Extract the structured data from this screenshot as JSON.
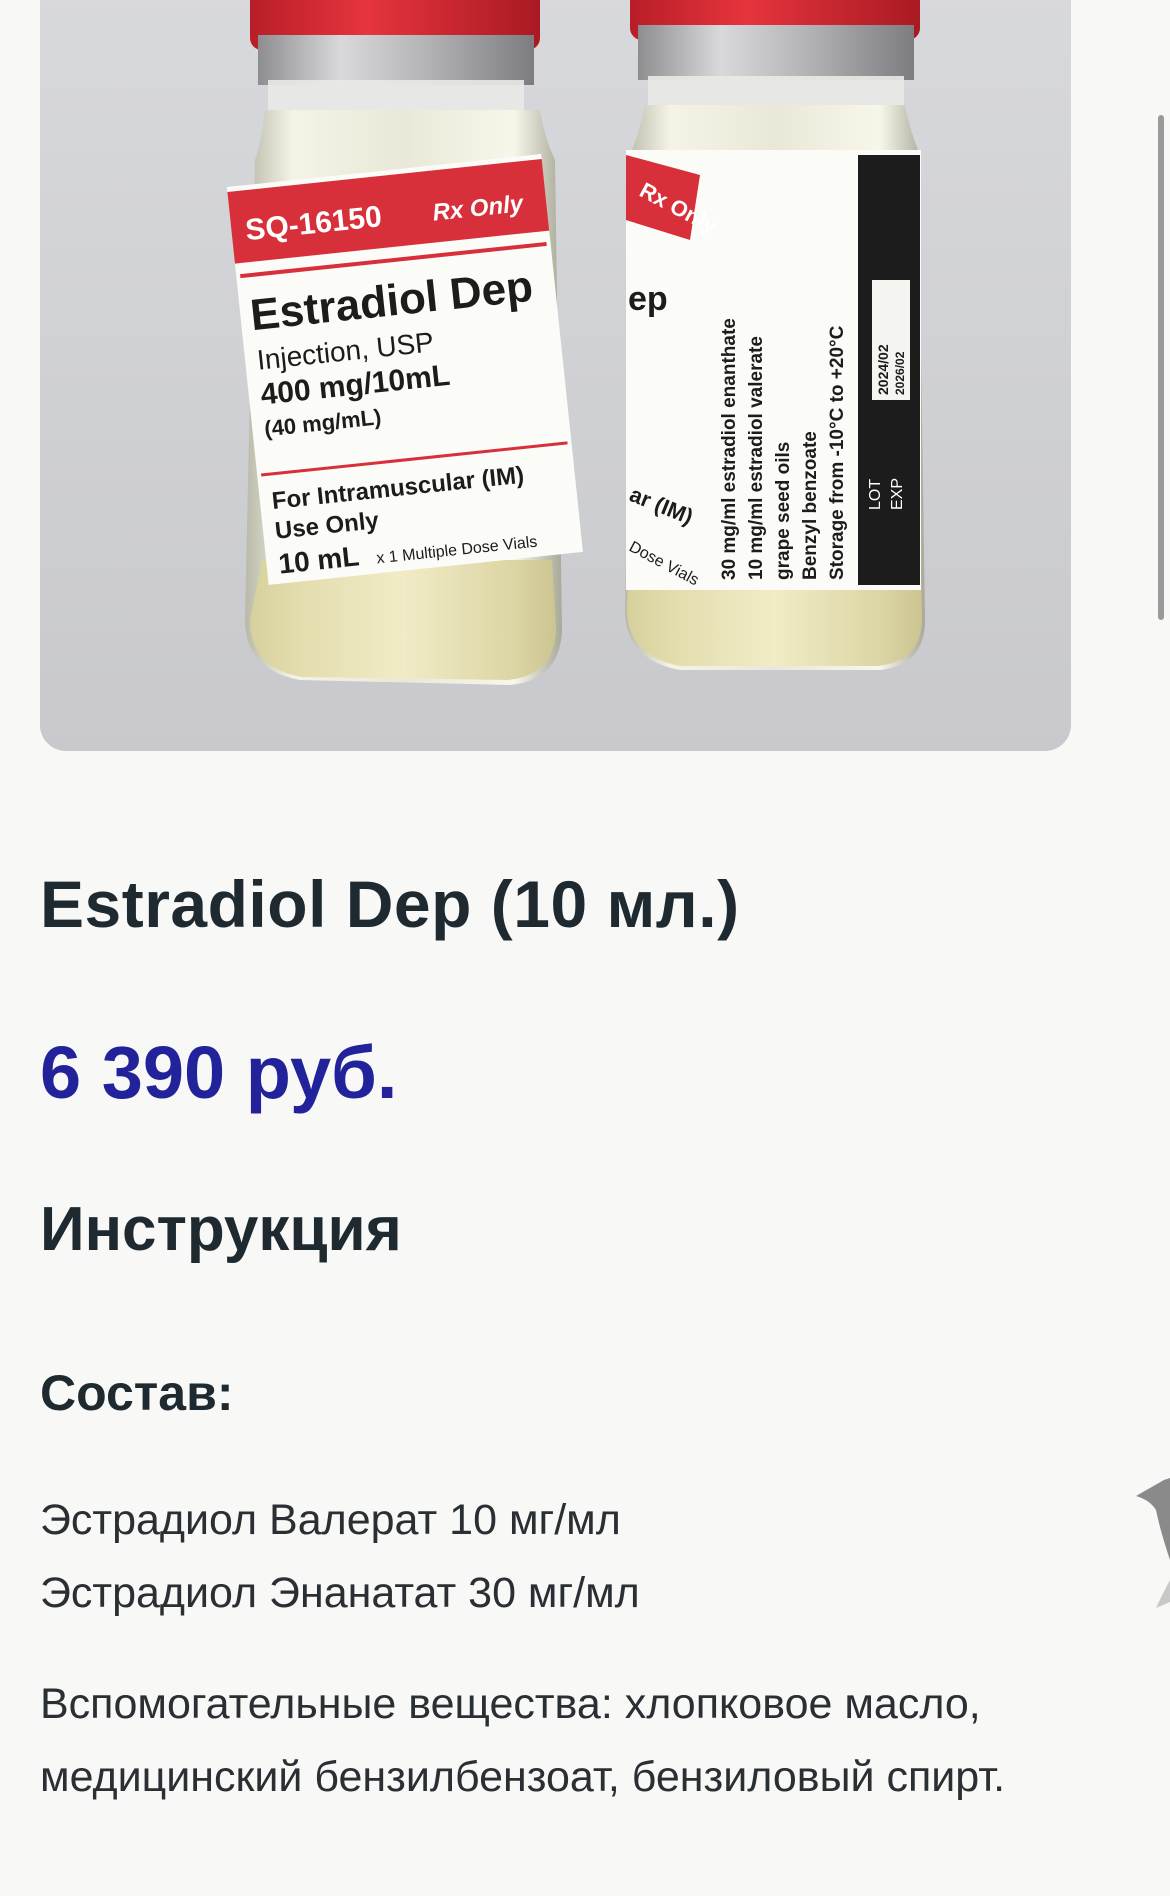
{
  "product": {
    "title": "Estradiol Dep (10 мл.)",
    "price": "6 390 руб.",
    "image_alt": "Estradiol Dep vials",
    "vial_front": {
      "code": "SQ-16150",
      "rx": "Rx Only",
      "name": "Estradiol Dep",
      "form": "Injection, USP",
      "strength": "400 mg/10mL",
      "per_ml": "(40 mg/mL)",
      "route_1": "For Intramuscular (IM)",
      "route_2": "Use Only",
      "volume": "10 mL",
      "vials": "x 1 Multiple Dose Vials"
    },
    "vial_back": {
      "rx": "Rx Only",
      "frag_name": "ep",
      "frag_route": "ar (IM)",
      "frag_vials": "Dose Vials",
      "line1": "30 mg/ml estradiol enanthate",
      "line2": "10 mg/ml estradiol valerate",
      "line3": "grape seed oils",
      "line4": "Benzyl benzoate",
      "line5": "Storage from -10°C to +20°C",
      "lot_label": "LOT",
      "exp_label": "EXP",
      "lot": "2024/02",
      "exp": "2026/02"
    }
  },
  "instructions": {
    "heading": "Инструкция",
    "composition_heading": "Состав:",
    "ingredients": [
      "Эстрадиол Валерат 10 мг/мл",
      "Эстрадиол Энанатат 30 мг/мл"
    ],
    "excipients": "Вспомогательные вещества: хлопковое масло, медицинский бензилбензоат, бензиловый спирт."
  },
  "colors": {
    "accent_price": "#22239a",
    "text_dark": "#1f2a30",
    "label_red": "#d8303a",
    "background": "#f8f8f7"
  }
}
